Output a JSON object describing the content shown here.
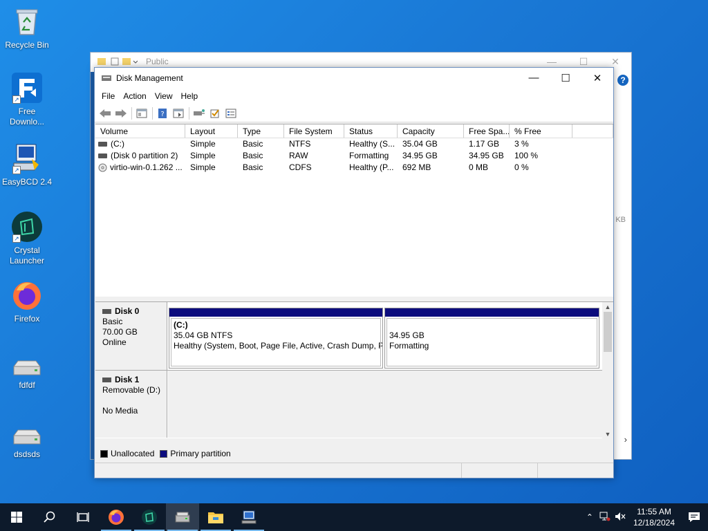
{
  "desktop": {
    "icons": [
      {
        "label": "Recycle Bin"
      },
      {
        "label": "Free Downlo..."
      },
      {
        "label": "EasyBCD 2.4"
      },
      {
        "label": "Crystal Launcher"
      },
      {
        "label": "Firefox"
      },
      {
        "label": "fdfdf"
      },
      {
        "label": "dsdsds"
      }
    ]
  },
  "explorer": {
    "title": "Public",
    "size_fragment": "KB"
  },
  "window": {
    "title": "Disk Management",
    "menu": [
      "File",
      "Action",
      "View",
      "Help"
    ]
  },
  "volumes": {
    "columns": [
      "Volume",
      "Layout",
      "Type",
      "File System",
      "Status",
      "Capacity",
      "Free Spa...",
      "% Free"
    ],
    "rows": [
      [
        "(C:)",
        "Simple",
        "Basic",
        "NTFS",
        "Healthy (S...",
        "35.04 GB",
        "1.17 GB",
        "3 %"
      ],
      [
        "(Disk 0 partition 2)",
        "Simple",
        "Basic",
        "RAW",
        "Formatting",
        "34.95 GB",
        "34.95 GB",
        "100 %"
      ],
      [
        "virtio-win-0.1.262 ...",
        "Simple",
        "Basic",
        "CDFS",
        "Healthy (P...",
        "692 MB",
        "0 MB",
        "0 %"
      ]
    ]
  },
  "disks": {
    "disk0": {
      "name": "Disk 0",
      "type": "Basic",
      "size": "70.00 GB",
      "state": "Online",
      "partitions": [
        {
          "name": "(C:)",
          "size": "35.04 GB NTFS",
          "status": "Healthy (System, Boot, Page File, Active, Crash Dump, Pri"
        },
        {
          "name": "",
          "size": "34.95 GB",
          "status": "Formatting"
        }
      ]
    },
    "disk1": {
      "name": "Disk 1",
      "type": "Removable (D:)",
      "state": "No Media"
    }
  },
  "legend": {
    "unallocated": "Unallocated",
    "primary": "Primary partition",
    "unallocated_color": "#000000",
    "primary_color": "#0c0c7e"
  },
  "taskbar": {
    "time": "11:55 AM",
    "date": "12/18/2024"
  }
}
